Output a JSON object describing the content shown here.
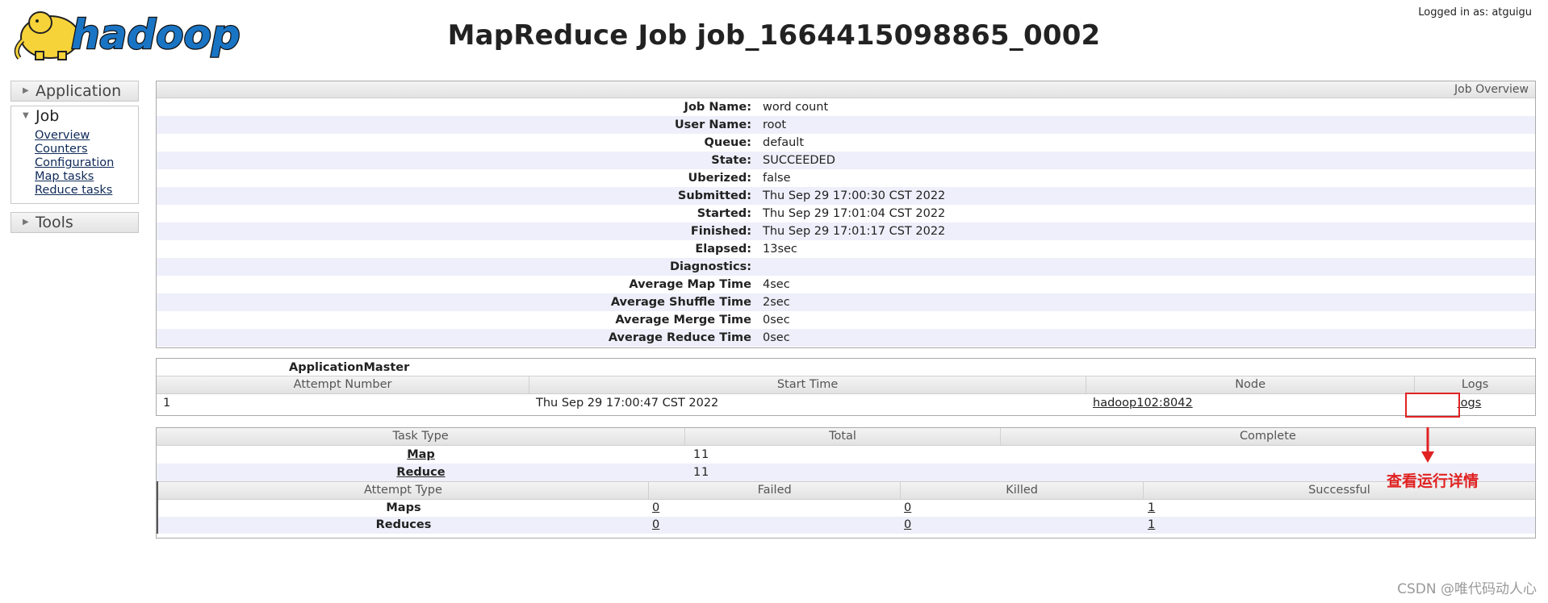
{
  "header": {
    "logo_text": "hadoop",
    "title": "MapReduce Job job_1664415098865_0002",
    "logged_in": "Logged in as: atguigu"
  },
  "sidebar": {
    "application": "Application",
    "job": "Job",
    "job_links": [
      "Overview",
      "Counters",
      "Configuration",
      "Map tasks",
      "Reduce tasks"
    ],
    "tools": "Tools"
  },
  "overview": {
    "heading": "Job Overview",
    "rows": [
      {
        "key": "Job Name:",
        "value": "word count"
      },
      {
        "key": "User Name:",
        "value": "root"
      },
      {
        "key": "Queue:",
        "value": "default"
      },
      {
        "key": "State:",
        "value": "SUCCEEDED"
      },
      {
        "key": "Uberized:",
        "value": "false"
      },
      {
        "key": "Submitted:",
        "value": "Thu Sep 29 17:00:30 CST 2022"
      },
      {
        "key": "Started:",
        "value": "Thu Sep 29 17:01:04 CST 2022"
      },
      {
        "key": "Finished:",
        "value": "Thu Sep 29 17:01:17 CST 2022"
      },
      {
        "key": "Elapsed:",
        "value": "13sec"
      },
      {
        "key": "Diagnostics:",
        "value": ""
      },
      {
        "key": "Average Map Time",
        "value": "4sec"
      },
      {
        "key": "Average Shuffle Time",
        "value": "2sec"
      },
      {
        "key": "Average Merge Time",
        "value": "0sec"
      },
      {
        "key": "Average Reduce Time",
        "value": "0sec"
      }
    ]
  },
  "app_master": {
    "title": "ApplicationMaster",
    "columns": [
      "Attempt Number",
      "Start Time",
      "Node",
      "Logs"
    ],
    "row": {
      "attempt": "1",
      "start_time": "Thu Sep 29 17:00:47 CST 2022",
      "node": "hadoop102:8042",
      "logs": "logs"
    }
  },
  "tasks": {
    "columns": [
      "Task Type",
      "Total",
      "Complete"
    ],
    "rows": [
      {
        "type": "Map",
        "total": "1",
        "complete": "1"
      },
      {
        "type": "Reduce",
        "total": "1",
        "complete": "1"
      }
    ],
    "attempt_columns": [
      "Attempt Type",
      "Failed",
      "Killed",
      "Successful"
    ],
    "attempt_rows": [
      {
        "type": "Maps",
        "failed": "0",
        "killed": "0",
        "successful": "1"
      },
      {
        "type": "Reduces",
        "failed": "0",
        "killed": "0",
        "successful": "1"
      }
    ]
  },
  "annotation": {
    "text": "查看运行详情",
    "color": "#e02222"
  },
  "watermark": "CSDN @唯代码动人心",
  "colors": {
    "alt_row": "#eeeffa",
    "link": "#0f2a57",
    "logo_yellow": "#f7d33a",
    "logo_blue": "#1a74c4"
  }
}
